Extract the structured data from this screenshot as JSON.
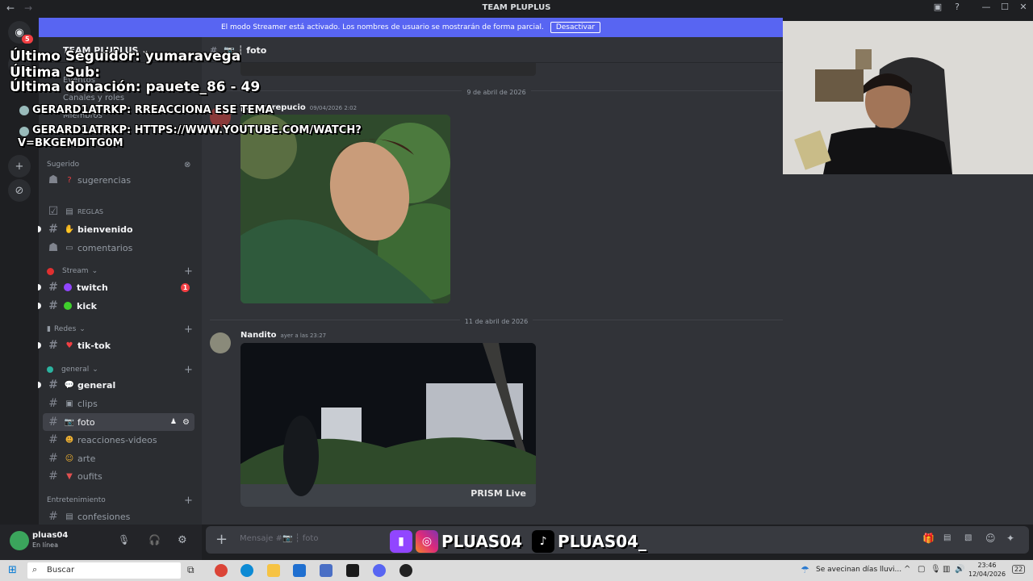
{
  "window": {
    "title": "TEAM PLUPLUS",
    "back": "←",
    "forward": "→",
    "min": "—",
    "max": "☐",
    "close": "✕"
  },
  "banner": {
    "text": "El modo Streamer está activado. Los nombres de usuario se mostrarán de forma parcial.",
    "button": "Desactivar"
  },
  "server": {
    "name": "TEAM PLUPLUS",
    "home_badge": "5"
  },
  "nav": {
    "events": "Eventos",
    "roles": "Canales y roles",
    "members": "Miembros"
  },
  "categories": {
    "suggested": "Sugerido",
    "stream": "Stream",
    "redes": "Redes",
    "general": "general",
    "entretenimiento": "Entretenimiento"
  },
  "channels": {
    "sugerencias": "sugerencias",
    "reglas": "REGLAS",
    "bienvenido": "bienvenido",
    "comentarios": "comentarios",
    "twitch": "twitch",
    "twitch_badge": "1",
    "kick": "kick",
    "tiktok": "tik-tok",
    "general": "general",
    "clips": "clips",
    "foto": "foto",
    "reacciones": "reacciones-videos",
    "arte": "arte",
    "oufits": "oufits",
    "confesiones": "confesiones"
  },
  "chat": {
    "header": "foto",
    "date1": "9 de abril de 2026",
    "msg1_author": "parazprepucio",
    "msg1_time": "09/04/2026 2:02",
    "date2": "11 de abril de 2026",
    "msg2_author": "Nandito",
    "msg2_time": "ayer a las 23:27",
    "img2_watermark": "PRISM Live",
    "composer_placeholder": "Mensaje #📷 ┆ foto"
  },
  "user": {
    "name": "pluas04",
    "status": "En línea"
  },
  "overlay": {
    "follower": "Último Seguidor: yumaravega",
    "sub": "Última Sub:",
    "donation": "Última donación: pauete_86 - 49",
    "chat1": "GERARD1ATRKP: RREACCIONA ESE TEMA",
    "chat2": "GERARD1ATRKP: HTTPS://WWW.YOUTUBE.COM/WATCH?",
    "chat3": "V=BKGEMDITG0M"
  },
  "social": {
    "handle1": "PLUAS04",
    "handle2": "PLUAS04_"
  },
  "taskbar": {
    "search": "Buscar",
    "weather": "Se avecinan días lluvi...",
    "time": "23:46",
    "date": "12/04/2026",
    "notif": "22"
  },
  "colors": {
    "accent": "#5865f2",
    "stream": "#e03030",
    "twitch": "#9146ff",
    "kick": "#53fc18"
  }
}
